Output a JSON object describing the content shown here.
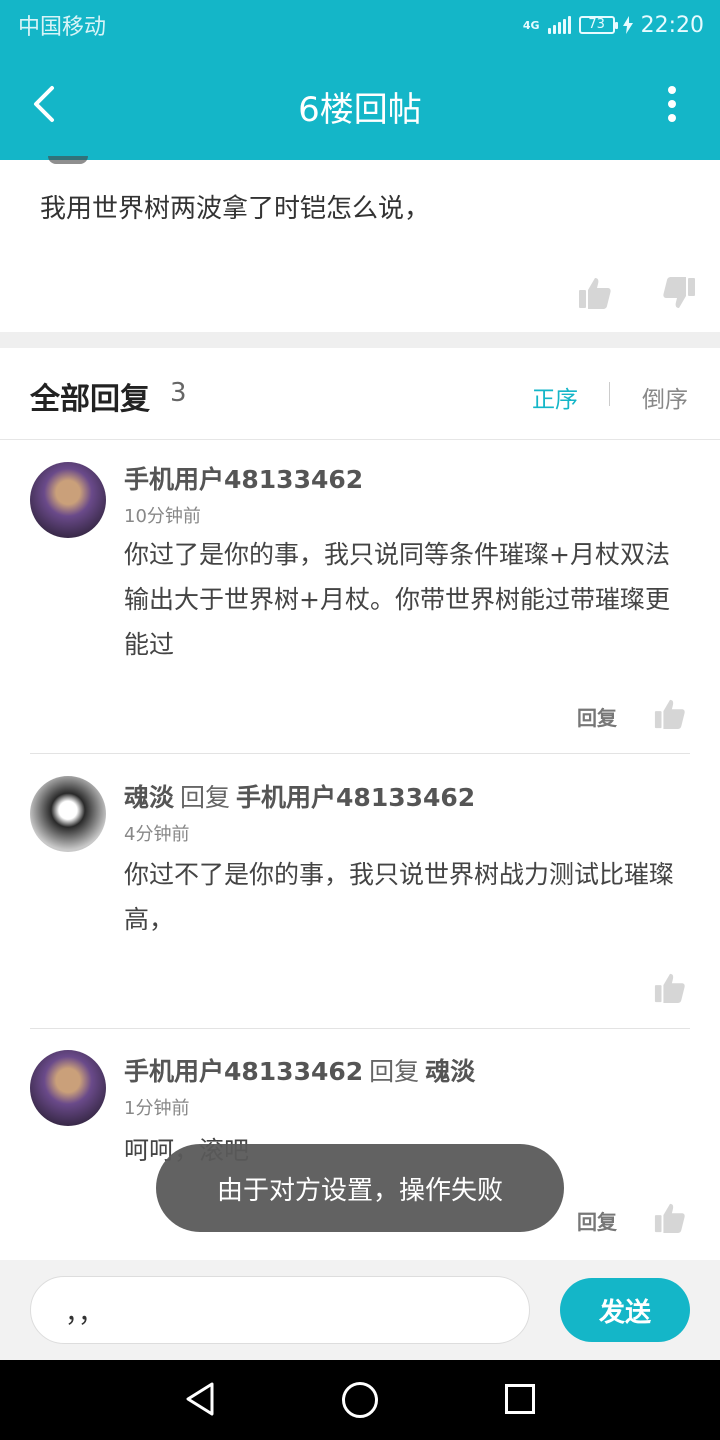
{
  "statusbar": {
    "carrier": "中国移动",
    "network": "4G",
    "battery": "73",
    "time": "22:20"
  },
  "header": {
    "title": "6楼回帖"
  },
  "post": {
    "text": "我用世界树两波拿了时铠怎么说，"
  },
  "replies": {
    "title": "全部回复",
    "count": "3",
    "sort_asc": "正序",
    "sort_desc": "倒序",
    "items": [
      {
        "author": "手机用户48133462",
        "reply_to_word": "",
        "reply_to": "",
        "time": "10分钟前",
        "content": "你过了是你的事，我只说同等条件璀璨+月杖双法输出大于世界树+月杖。你带世界树能过带璀璨更能过",
        "reply_label": "回复"
      },
      {
        "author": "魂淡",
        "reply_to_word": "回复",
        "reply_to": "手机用户48133462",
        "time": "4分钟前",
        "content": "你过不了是你的事，我只说世界树战力测试比璀璨高，",
        "reply_label": ""
      },
      {
        "author": "手机用户48133462",
        "reply_to_word": "回复",
        "reply_to": "魂淡",
        "time": "1分钟前",
        "content": "呵呵，滚吧",
        "reply_label": "回复"
      }
    ]
  },
  "toast": {
    "text": "由于对方设置，操作失败"
  },
  "input": {
    "value": "，，",
    "send_label": "发送"
  },
  "icons": {
    "back": "chevron-left-icon",
    "more": "more-vertical-icon",
    "like": "thumbs-up-icon",
    "dislike": "thumbs-down-icon"
  },
  "colors": {
    "accent": "#14b6c8",
    "toast_bg": "#5a5a5a"
  }
}
